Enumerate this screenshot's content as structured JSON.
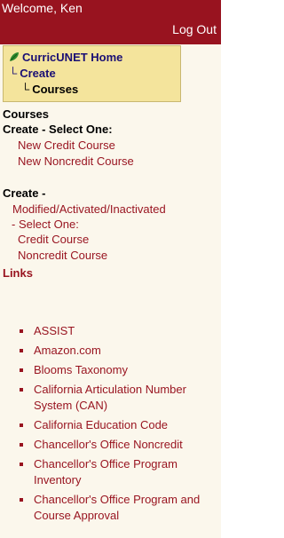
{
  "header": {
    "welcome": "Welcome, Ken",
    "logout": "Log Out"
  },
  "breadcrumb": {
    "home": "CurricUNET Home",
    "create": "Create",
    "courses": "Courses"
  },
  "menu": {
    "courses_heading": "Courses",
    "create_select_heading": "Create - Select One:",
    "new_credit": "New Credit Course",
    "new_noncredit": "New Noncredit Course",
    "create_heading": "Create -",
    "mod_line": "Modified/Activated/Inactivated",
    "select_one": "- Select One:",
    "credit_course": "Credit Course",
    "noncredit_course": "Noncredit Course",
    "links_heading": "Links"
  },
  "links": [
    "ASSIST",
    "Amazon.com",
    "Blooms Taxonomy",
    "California Articulation Number System (CAN)",
    "California Education Code",
    "Chancellor's Office Noncredit",
    "Chancellor's Office Program Inventory",
    "Chancellor's Office Program and Course Approval"
  ],
  "colors": {
    "accent": "#98131f",
    "breadcrumb_bg": "#f4e49c",
    "sidebar_bg": "#fbf7ec"
  }
}
